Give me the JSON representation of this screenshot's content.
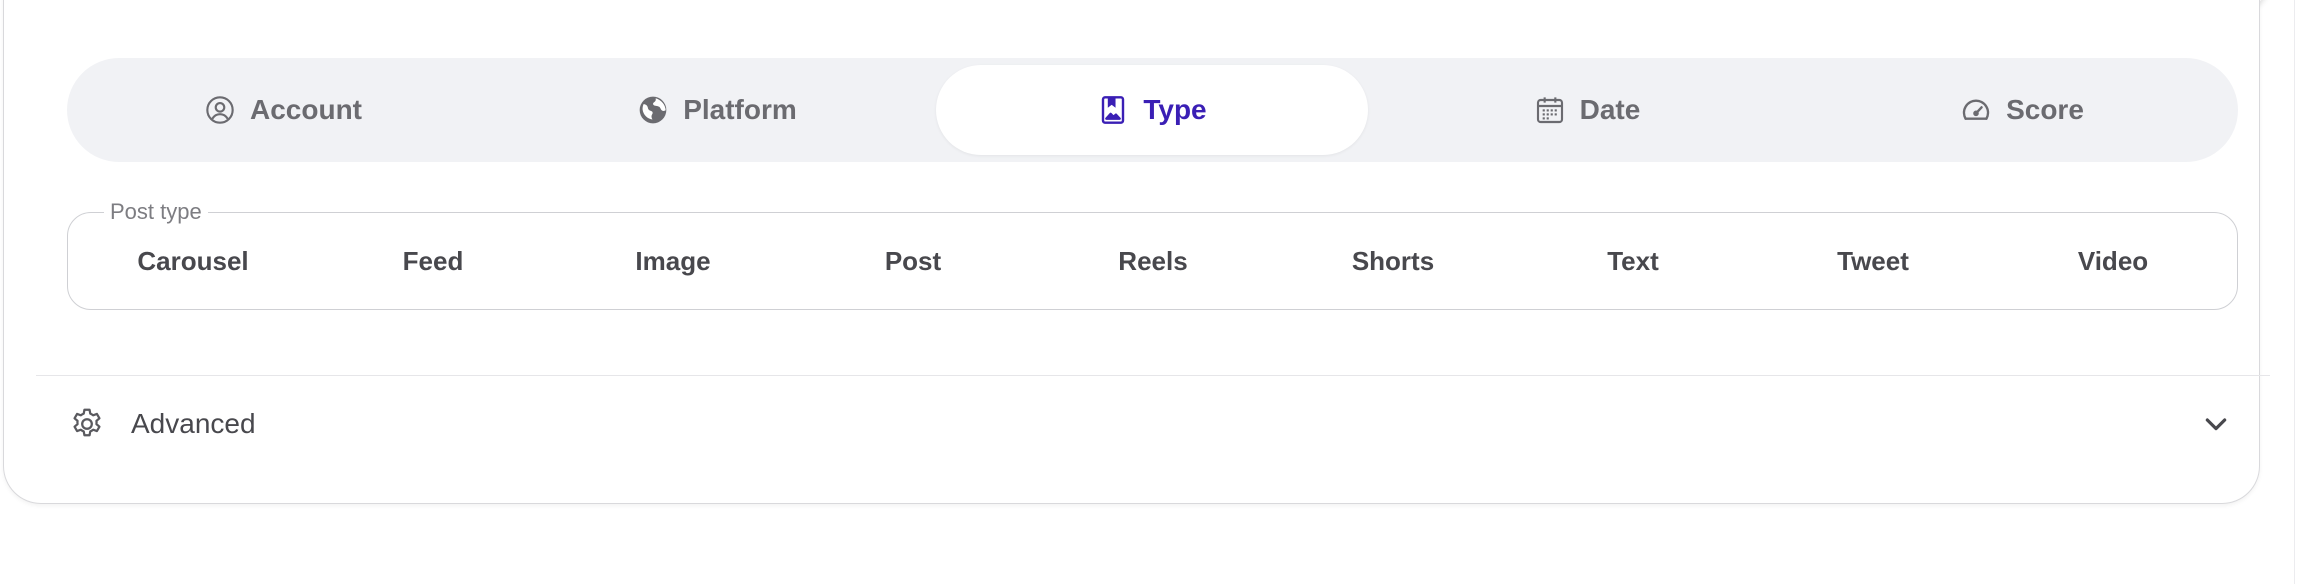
{
  "tabs": [
    {
      "label": "Account",
      "icon": "user-circle-icon"
    },
    {
      "label": "Platform",
      "icon": "globe-icon"
    },
    {
      "label": "Type",
      "icon": "bookmark-image-icon",
      "active": true
    },
    {
      "label": "Date",
      "icon": "calendar-icon"
    },
    {
      "label": "Score",
      "icon": "gauge-icon"
    }
  ],
  "post_type": {
    "legend": "Post type",
    "options": [
      "Carousel",
      "Feed",
      "Image",
      "Post",
      "Reels",
      "Shorts",
      "Text",
      "Tweet",
      "Video"
    ]
  },
  "advanced": {
    "label": "Advanced",
    "icon": "gear-icon",
    "toggle_icon": "chevron-down-icon"
  },
  "colors": {
    "accent": "#3a1fb5",
    "tab_bar": "#f1f2f5",
    "text": "#48484d",
    "muted": "#6b6b70"
  }
}
